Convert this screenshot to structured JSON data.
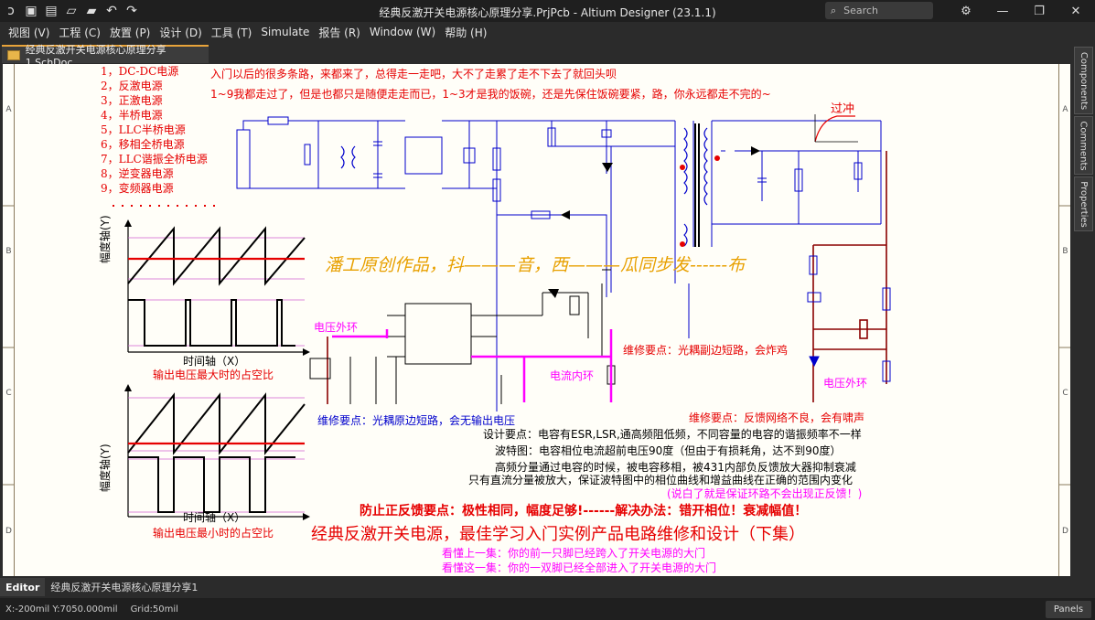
{
  "window": {
    "title": "经典反激开关电源核心原理分享.PrjPcb - Altium Designer (23.1.1)",
    "search_placeholder": "Search"
  },
  "menu": [
    "视图 (V)",
    "工程 (C)",
    "放置 (P)",
    "设计 (D)",
    "工具 (T)",
    "Simulate",
    "报告 (R)",
    "Window (W)",
    "帮助 (H)"
  ],
  "doc_tab": "经典反激开关电源核心原理分享1.SchDoc",
  "right_panels": [
    "Components",
    "Comments",
    "Properties"
  ],
  "bottom": {
    "editor_tab": "Editor",
    "doc_tab": "经典反激开关电源核心原理分享1"
  },
  "status": {
    "coords": "X:-200mil Y:7050.000mil",
    "grid": "Grid:50mil",
    "panels": "Panels"
  },
  "zones": {
    "left": [
      "A",
      "B",
      "C",
      "D"
    ]
  },
  "schematic": {
    "list": [
      "1，DC-DC电源",
      "2，反激电源",
      "3，正激电源",
      "4，半桥电源",
      "5，LLC半桥电源",
      "6，移相全桥电源",
      "7，LLC谐振全桥电源",
      "8，逆变器电源",
      "9，变频器电源"
    ],
    "intro1": "入门以后的很多条路，来都来了，总得走一走吧，大不了走累了走不下去了就回头呗",
    "intro2": "1~9我都走过了，但是也都只是随便走走而已，1~3才是我的饭碗，还是先保住饭碗要紧，路，你永远都走不完的~",
    "overshoot": "过冲",
    "watermark": "潘工原创作品，抖———音，西———瓜同步发------布",
    "chart1_ylabel": "幅度轴(Y)",
    "chart1_xlabel": "时间轴（X）",
    "chart1_caption": "输出电压最大时的占空比",
    "chart2_ylabel": "幅度轴(Y)",
    "chart2_xlabel": "时间轴（X）",
    "chart2_caption": "输出电压最小时的占空比",
    "voltage_loop_left": "电压外环",
    "voltage_loop_right": "电压外环",
    "current_loop": "电流内环",
    "repair1": "维修要点：光耦副边短路，会炸鸡",
    "repair2": "维修要点：光耦原边短路，会无输出电压",
    "repair3": "维修要点：反馈网络不良，会有啸声",
    "design1": "设计要点：电容有ESR,LSR,通高频阻低频，不同容量的电容的谐振频率不一样",
    "design2": "波特图：电容相位电流超前电压90度（但由于有损耗角，达不到90度）",
    "design3": "高频分量通过电容的时候，被电容移相，被431内部负反馈放大器抑制衰减",
    "design4": "只有直流分量被放大，保证波特图中的相位曲线和增益曲线在正确的范围内变化",
    "design5": "(说白了就是保证环路不会出现正反馈！)",
    "key": "防止正反馈要点：极性相同，幅度足够!------解决办法：错开相位！衰减幅值！",
    "headline": "经典反激开关电源，最佳学习入门实例产品电路维修和设计（下集）",
    "footer1": "看懂上一集：你的前一只脚已经跨入了开关电源的大门",
    "footer2": "看懂这一集：你的一双脚已经全部进入了开关电源的大门"
  },
  "colors": {
    "accent": "#e8a33a",
    "red": "#e60000",
    "blue": "#0000cc",
    "magenta": "#ff00ff",
    "orange": "#e8a000",
    "wire_dark": "#8b0000"
  }
}
